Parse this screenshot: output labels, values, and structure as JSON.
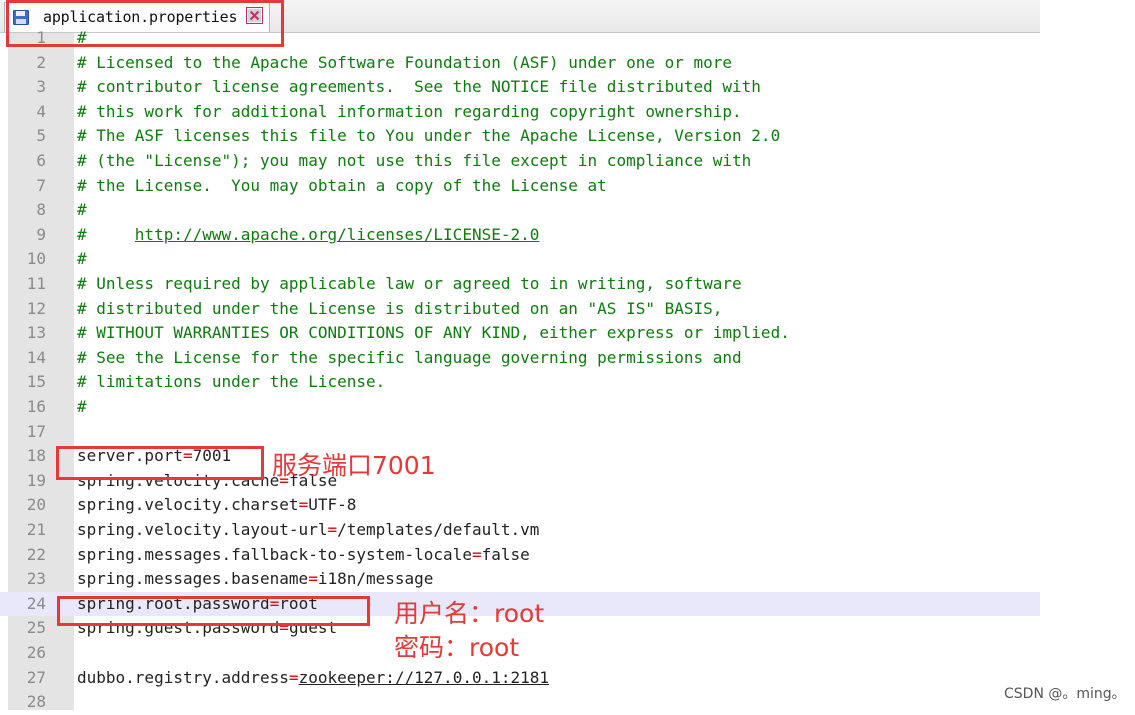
{
  "tab": {
    "title": "application.properties",
    "file_icon": "floppy-disk-icon",
    "close_icon": "close-x-icon"
  },
  "lines": [
    {
      "n": "1",
      "kind": "comment",
      "text": "#"
    },
    {
      "n": "2",
      "kind": "comment",
      "text": "# Licensed to the Apache Software Foundation (ASF) under one or more"
    },
    {
      "n": "3",
      "kind": "comment",
      "text": "# contributor license agreements.  See the NOTICE file distributed with"
    },
    {
      "n": "4",
      "kind": "comment",
      "text": "# this work for additional information regarding copyright ownership."
    },
    {
      "n": "5",
      "kind": "comment",
      "text": "# The ASF licenses this file to You under the Apache License, Version 2.0"
    },
    {
      "n": "6",
      "kind": "comment",
      "text": "# (the \"License\"); you may not use this file except in compliance with"
    },
    {
      "n": "7",
      "kind": "comment",
      "text": "# the License.  You may obtain a copy of the License at"
    },
    {
      "n": "8",
      "kind": "comment",
      "text": "#"
    },
    {
      "n": "9",
      "kind": "comment-link",
      "text": "#     ",
      "link": "http://www.apache.org/licenses/LICENSE-2.0"
    },
    {
      "n": "10",
      "kind": "comment",
      "text": "#"
    },
    {
      "n": "11",
      "kind": "comment",
      "text": "# Unless required by applicable law or agreed to in writing, software"
    },
    {
      "n": "12",
      "kind": "comment",
      "text": "# distributed under the License is distributed on an \"AS IS\" BASIS,"
    },
    {
      "n": "13",
      "kind": "comment",
      "text": "# WITHOUT WARRANTIES OR CONDITIONS OF ANY KIND, either express or implied."
    },
    {
      "n": "14",
      "kind": "comment",
      "text": "# See the License for the specific language governing permissions and"
    },
    {
      "n": "15",
      "kind": "comment",
      "text": "# limitations under the License."
    },
    {
      "n": "16",
      "kind": "comment",
      "text": "#"
    },
    {
      "n": "17",
      "kind": "blank",
      "text": ""
    },
    {
      "n": "18",
      "kind": "prop",
      "key": "server.port",
      "value": "7001"
    },
    {
      "n": "19",
      "kind": "prop",
      "key": "spring.velocity.cache",
      "value": "false"
    },
    {
      "n": "20",
      "kind": "prop",
      "key": "spring.velocity.charset",
      "value": "UTF-8"
    },
    {
      "n": "21",
      "kind": "prop",
      "key": "spring.velocity.layout-url",
      "value": "/templates/default.vm"
    },
    {
      "n": "22",
      "kind": "prop",
      "key": "spring.messages.fallback-to-system-locale",
      "value": "false"
    },
    {
      "n": "23",
      "kind": "prop",
      "key": "spring.messages.basename",
      "value": "i18n/message"
    },
    {
      "n": "24",
      "kind": "prop",
      "key": "spring.root.password",
      "value": "root",
      "highlight": true
    },
    {
      "n": "25",
      "kind": "prop",
      "key": "spring.guest.password",
      "value": "guest"
    },
    {
      "n": "26",
      "kind": "blank",
      "text": ""
    },
    {
      "n": "27",
      "kind": "prop-url",
      "key": "dubbo.registry.address",
      "value": "zookeeper://127.0.0.1:2181"
    },
    {
      "n": "28",
      "kind": "blank",
      "text": ""
    }
  ],
  "annotations": {
    "port_note": "服务端口7001",
    "username_note": "用户名：root",
    "password_note": "密码：root"
  },
  "watermark": "CSDN @。ming。",
  "colors": {
    "comment": "#0c7d0c",
    "equals": "#e00000",
    "annotation_red": "#e63838",
    "highlight": "#e8e8fa",
    "gutter": "#e4e4e4"
  }
}
